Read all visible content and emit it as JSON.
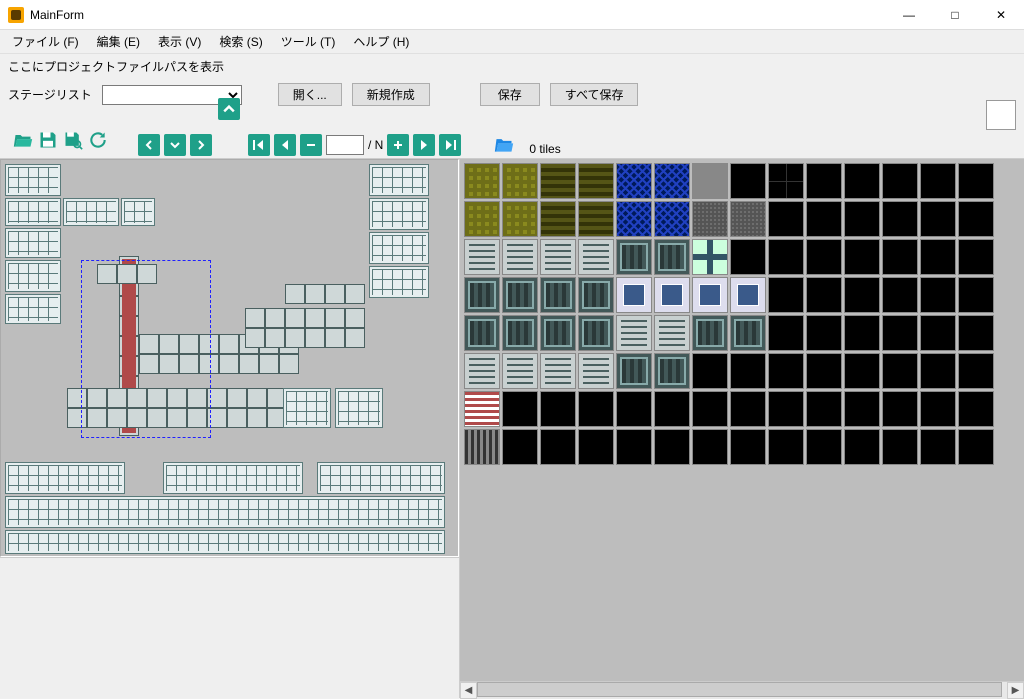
{
  "window": {
    "title": "MainForm"
  },
  "menu": {
    "file": "ファイル (F)",
    "edit": "編集 (E)",
    "view": "表示 (V)",
    "search": "検索 (S)",
    "tool": "ツール (T)",
    "help": "ヘルプ (H)"
  },
  "pathbar": {
    "label": "ここにプロジェクトファイルパスを表示"
  },
  "stagebar": {
    "label": "ステージリスト",
    "open": "開く...",
    "new": "新規作成",
    "save": "保存",
    "save_all": "すべて保存"
  },
  "toolbar": {
    "page_suffix": "/ N",
    "page_value": ""
  },
  "palette": {
    "count_label": "0 tiles"
  },
  "colors": {
    "teal": "#1fa089",
    "blue_folder": "#1e88e5"
  },
  "win_buttons": {
    "min": "—",
    "max": "□",
    "close": "✕"
  }
}
